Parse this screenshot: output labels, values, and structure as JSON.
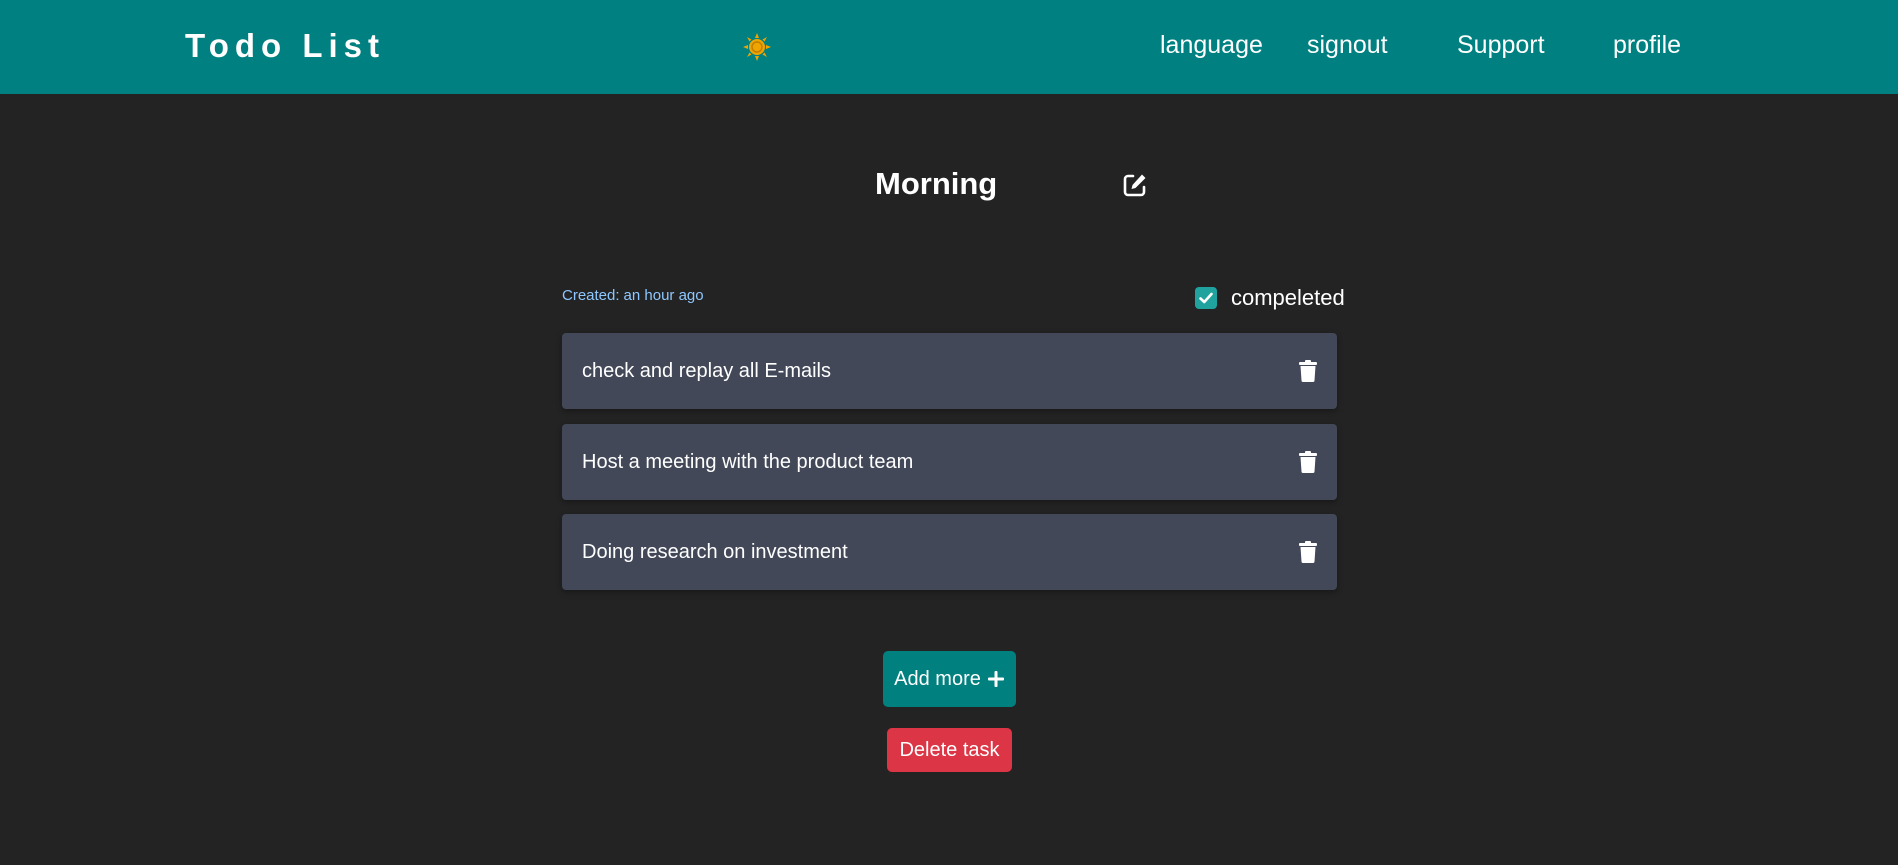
{
  "header": {
    "brand": "Todo List",
    "theme_icon": "sun-icon",
    "nav": {
      "language": "language",
      "signout": "signout",
      "support": "Support",
      "profile": "profile"
    }
  },
  "list": {
    "title": "Morning",
    "edit_icon": "edit-icon",
    "created_label": "Created:",
    "created_value": "an hour ago",
    "completed_label": "compeleted",
    "completed_checked": true,
    "tasks": [
      {
        "text": "check and replay all E-mails"
      },
      {
        "text": "Host a meeting with the product team"
      },
      {
        "text": "Doing research on investment"
      }
    ]
  },
  "actions": {
    "add_more": "Add more",
    "delete_task": "Delete task"
  },
  "colors": {
    "header_bg": "#008080",
    "page_bg": "#232323",
    "task_bg": "#424858",
    "sun": "#f0a400",
    "danger": "#dc3545",
    "created_text": "#8ec7ff"
  }
}
